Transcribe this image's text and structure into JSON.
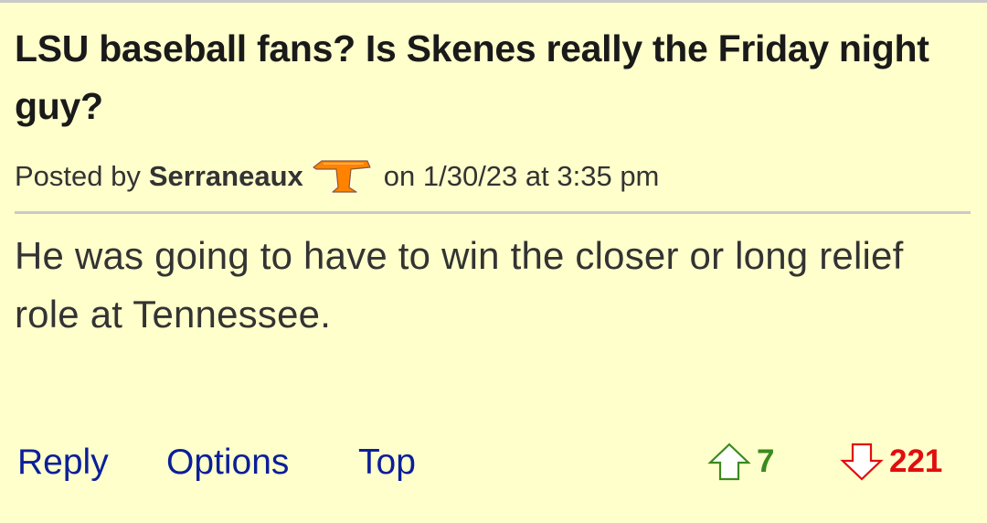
{
  "post": {
    "title": "LSU baseball fans? Is Skenes really the Friday night guy?",
    "posted_by_label": "Posted by",
    "author": "Serraneaux",
    "team_icon": "tennessee-power-t-icon",
    "date_text": "on 1/30/23 at 3:35 pm",
    "body": "He was going to have to win the closer or long relief role at Tennessee."
  },
  "actions": {
    "reply_label": "Reply",
    "options_label": "Options",
    "top_label": "Top"
  },
  "votes": {
    "up_count": "7",
    "down_count": "221",
    "up_color": "#3c8a1e",
    "down_color": "#e00e0e"
  },
  "colors": {
    "background": "#ffffcc",
    "link": "#0b1f99",
    "tennessee_orange": "#ff8200"
  }
}
